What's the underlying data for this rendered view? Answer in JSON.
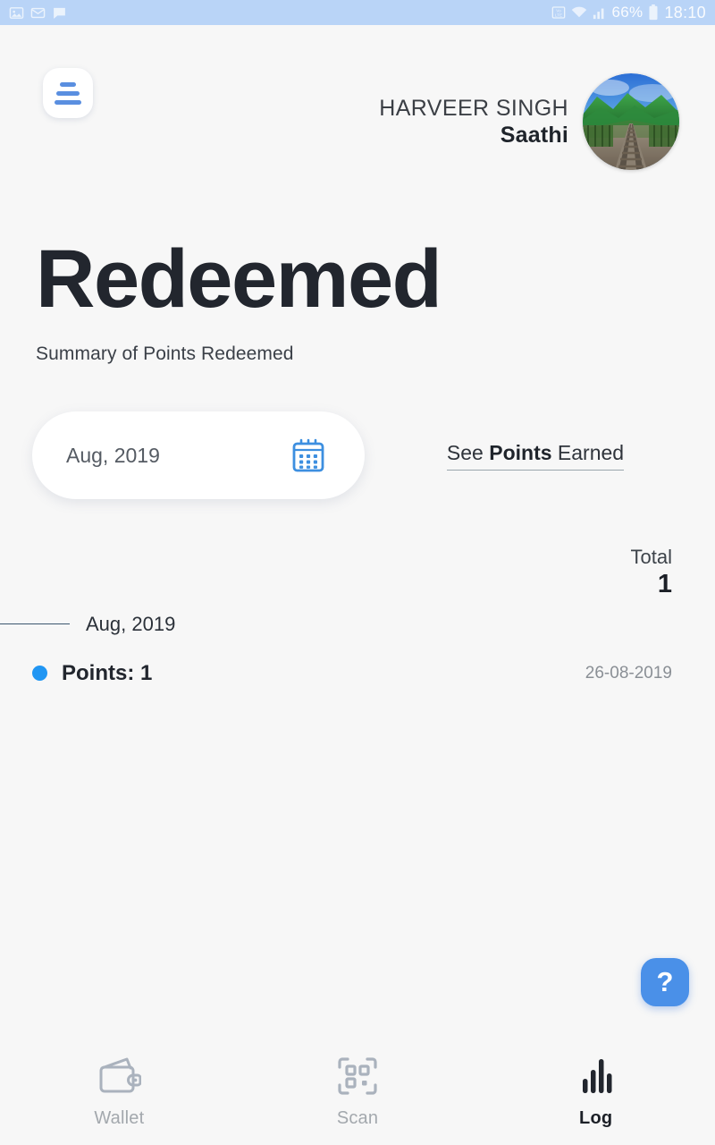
{
  "status_bar": {
    "left_icons": [
      "image-icon",
      "email-icon",
      "chat-icon"
    ],
    "volte_label": "VoLTE",
    "wifi_icon": "wifi-icon",
    "signal_icon": "signal-bars-icon",
    "battery_percent": "66%",
    "battery_icon": "battery-icon",
    "time": "18:10",
    "background_color": "#b9d4f7"
  },
  "header": {
    "menu_icon": "hamburger-menu-icon",
    "user_name": "HARVEER SINGH",
    "user_role": "Saathi",
    "avatar_alt": "railway-track-avatar"
  },
  "page": {
    "title": "Redeemed",
    "subtitle": "Summary of Points Redeemed"
  },
  "filter": {
    "month_value": "Aug, 2019",
    "calendar_icon": "calendar-icon",
    "earned_link_prefix": "See ",
    "earned_link_bold": "Points",
    "earned_link_suffix": " Earned"
  },
  "summary": {
    "total_label": "Total",
    "total_value": "1"
  },
  "group": {
    "label": "Aug, 2019",
    "entries": [
      {
        "bullet_color": "#2196f3",
        "text": "Points: 1",
        "date": "26-08-2019"
      }
    ]
  },
  "help": {
    "label": "?"
  },
  "bottom_nav": {
    "items": [
      {
        "label": "Wallet",
        "icon": "wallet-icon",
        "active": false
      },
      {
        "label": "Scan",
        "icon": "qr-scan-icon",
        "active": false
      },
      {
        "label": "Log",
        "icon": "bar-chart-icon",
        "active": true
      }
    ]
  },
  "colors": {
    "accent_blue": "#2196f3",
    "status_bar": "#b9d4f7",
    "background": "#f7f7f7",
    "title_dark": "#22262e"
  }
}
